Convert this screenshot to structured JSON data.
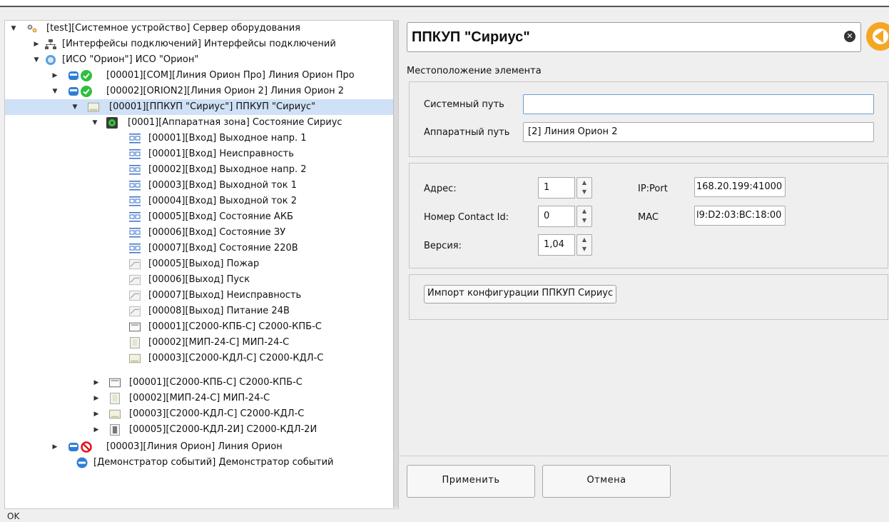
{
  "tree": {
    "items": [
      {
        "label": "[test][Системное устройство] Сервер оборудования",
        "arrow": "▼",
        "icon": "gears-icon"
      },
      {
        "label": "[Интерфейсы подключений] Интерфейсы подключений",
        "arrow": "▶",
        "icon": "network-icon"
      },
      {
        "label": "[ИСО \"Орион\"] ИСО \"Орион\"",
        "arrow": "▼",
        "icon": "orion-icon"
      },
      {
        "label": "[00001][COM][Линия Орион Про] Линия Орион Про",
        "arrow": "▶",
        "icon": "line-ok-icon"
      },
      {
        "label": "[00002][ORION2][Линия Орион 2] Линия Орион 2",
        "arrow": "▼",
        "icon": "line-ok-icon"
      },
      {
        "label": "[00001][ППКУП \"Сириус\"] ППКУП \"Сириус\"",
        "arrow": "▼",
        "icon": "device-icon"
      },
      {
        "label": "[0001][Аппаратная зона] Состояние Сириус",
        "arrow": "▼",
        "icon": "zone-icon"
      },
      {
        "label": "[00001][Вход] Выходное напр. 1",
        "icon": "input-icon"
      },
      {
        "label": "[00001][Вход] Неисправность",
        "icon": "input-icon"
      },
      {
        "label": "[00002][Вход] Выходное напр. 2",
        "icon": "input-icon"
      },
      {
        "label": "[00003][Вход] Выходной ток 1",
        "icon": "input-icon"
      },
      {
        "label": "[00004][Вход] Выходной ток 2",
        "icon": "input-icon"
      },
      {
        "label": "[00005][Вход] Состояние АКБ",
        "icon": "input-icon"
      },
      {
        "label": "[00006][Вход] Состояние ЗУ",
        "icon": "input-icon"
      },
      {
        "label": "[00007][Вход] Состояние 220В",
        "icon": "input-icon"
      },
      {
        "label": "[00005][Выход] Пожар",
        "icon": "output-icon"
      },
      {
        "label": "[00006][Выход] Пуск",
        "icon": "output-icon"
      },
      {
        "label": "[00007][Выход] Неисправность",
        "icon": "output-icon"
      },
      {
        "label": "[00008][Выход] Питание 24В",
        "icon": "output-icon"
      },
      {
        "label": "[00001][С2000-КПБ-С] С2000-КПБ-С",
        "icon": "kpb-icon"
      },
      {
        "label": "[00002][МИП-24-С] МИП-24-С",
        "icon": "mip-icon"
      },
      {
        "label": "[00003][С2000-КДЛ-С] С2000-КДЛ-С",
        "icon": "kdl-icon"
      },
      {
        "label": "[00001][С2000-КПБ-С] С2000-КПБ-С",
        "arrow": "▶",
        "icon": "kpb-icon"
      },
      {
        "label": "[00002][МИП-24-С] МИП-24-С",
        "arrow": "▶",
        "icon": "mip-icon"
      },
      {
        "label": "[00003][С2000-КДЛ-С] С2000-КДЛ-С",
        "arrow": "▶",
        "icon": "kdl-icon"
      },
      {
        "label": "[00005][С2000-КДЛ-2И] С2000-КДЛ-2И",
        "arrow": "▶",
        "icon": "kdl2-icon"
      },
      {
        "label": "[00003][Линия Орион] Линия Орион",
        "arrow": "▶",
        "icon": "line-disabled-icon"
      },
      {
        "label": "[Демонстратор событий] Демонстратор событий",
        "icon": "demo-icon"
      }
    ]
  },
  "header": {
    "title": "ППКУП \"Сириус\""
  },
  "location": {
    "caption": "Местоположение элемента",
    "system_path_label": "Системный путь",
    "system_path_value": "",
    "hardware_path_label": "Аппаратный путь",
    "hardware_path_value": "[2] Линия Орион 2"
  },
  "params": {
    "address_label": "Адрес:",
    "address_value": "1",
    "contact_id_label": "Номер Contact Id:",
    "contact_id_value": "0",
    "version_label": "Версия:",
    "version_value": "1,04",
    "ip_label": "IP:Port",
    "ip_value": "168.20.199:41000",
    "mac_label": "MAC",
    "mac_value": "l9:D2:03:BC:18:00"
  },
  "import_button": "Импорт конфигурации ППКУП Сириус",
  "actions": {
    "apply": "Применить",
    "cancel": "Отмена"
  },
  "status": "OK",
  "colors": {
    "selection": "#cfe1f6",
    "accent": "#f5a623",
    "ok": "#2fbf3f",
    "error": "#e0141e",
    "device_blue": "#2f7fd6"
  }
}
